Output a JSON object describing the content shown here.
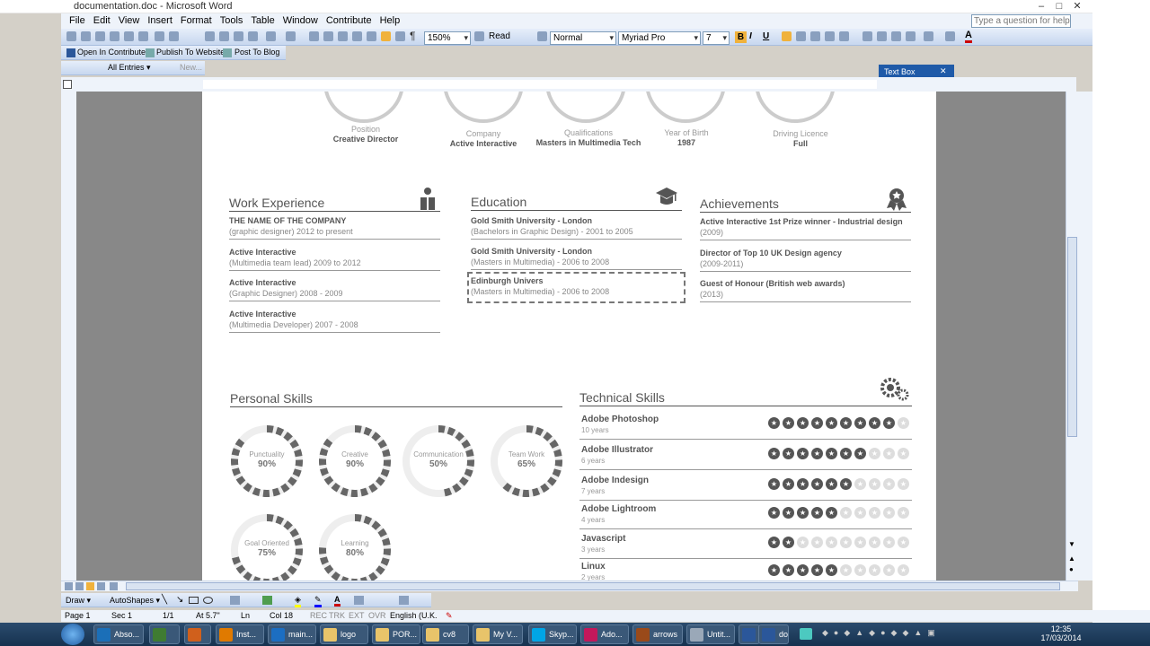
{
  "window": {
    "title": "documentation.doc - Microsoft Word"
  },
  "menu": [
    "File",
    "Edit",
    "View",
    "Insert",
    "Format",
    "Tools",
    "Table",
    "Window",
    "Contribute",
    "Help"
  ],
  "help_placeholder": "Type a question for help",
  "toolbar": {
    "zoom": "150%",
    "read": "Read",
    "style": "Normal",
    "font": "Myriad Pro",
    "size": "7"
  },
  "contribute": {
    "open": "Open In Contribute",
    "publish": "Publish To Website",
    "blog": "Post To Blog",
    "entries": "All Entries",
    "new": "New..."
  },
  "textbox_toolbar": {
    "title": "Text Box"
  },
  "resume": {
    "info": [
      {
        "label": "Position",
        "value": "Creative Director"
      },
      {
        "label": "Company",
        "value": "Active Interactive"
      },
      {
        "label": "Qualifications",
        "value": "Masters in Multimedia Tech"
      },
      {
        "label": "Year of Birth",
        "value": "1987"
      },
      {
        "label": "Driving Licence",
        "value": "Full"
      }
    ],
    "work": {
      "title": "Work Experience",
      "items": [
        {
          "a": "THE NAME OF THE COMPANY",
          "b": "(graphic designer) 2012 to present"
        },
        {
          "a": "Active Interactive",
          "b": "(Multimedia team lead) 2009 to 2012"
        },
        {
          "a": "Active Interactive",
          "b": "(Graphic Designer) 2008 - 2009"
        },
        {
          "a": "Active Interactive",
          "b": "(Multimedia Developer) 2007 - 2008"
        }
      ]
    },
    "education": {
      "title": "Education",
      "items": [
        {
          "a": "Gold Smith University - London",
          "b": "(Bachelors in Graphic Design) - 2001 to 2005"
        },
        {
          "a": "Gold Smith University - London",
          "b": "(Masters in Multimedia) - 2006 to 2008"
        },
        {
          "a": "Edinburgh Univers",
          "b": "(Masters in Multimedia) - 2006 to 2008"
        }
      ]
    },
    "achievements": {
      "title": "Achievements",
      "items": [
        {
          "a": "Active Interactive 1st Prize winner - Industrial design",
          "b": "(2009)"
        },
        {
          "a": "Director of Top 10 UK Design agency",
          "b": "(2009-2011)"
        },
        {
          "a": "Guest of Honour (British web awards)",
          "b": "(2013)"
        }
      ]
    },
    "personal": {
      "title": "Personal Skills",
      "items": [
        {
          "label": "Punctuality",
          "pct": "90%",
          "v": 0.9
        },
        {
          "label": "Creative",
          "pct": "90%",
          "v": 0.9
        },
        {
          "label": "Communication",
          "pct": "50%",
          "v": 0.5
        },
        {
          "label": "Team Work",
          "pct": "65%",
          "v": 0.65
        },
        {
          "label": "Goal Oriented",
          "pct": "75%",
          "v": 0.75
        },
        {
          "label": "Learning",
          "pct": "80%",
          "v": 0.8
        }
      ]
    },
    "technical": {
      "title": "Technical Skills",
      "items": [
        {
          "name": "Adobe Photoshop",
          "years": "10 years",
          "stars": 9
        },
        {
          "name": "Adobe Illustrator",
          "years": "6 years",
          "stars": 7
        },
        {
          "name": "Adobe Indesign",
          "years": "7 years",
          "stars": 6
        },
        {
          "name": "Adobe Lightroom",
          "years": "4 years",
          "stars": 5
        },
        {
          "name": "Javascript",
          "years": "3 years",
          "stars": 2
        },
        {
          "name": "Linux",
          "years": "2 years",
          "stars": 5
        }
      ]
    }
  },
  "drawing": {
    "draw": "Draw",
    "autoshapes": "AutoShapes"
  },
  "status": {
    "page": "Page 1",
    "sec": "Sec 1",
    "pages": "1/1",
    "at": "At 5.7\"",
    "ln": "Ln",
    "col": "Col 18",
    "rec": "REC",
    "trk": "TRK",
    "ext": "EXT",
    "ovr": "OVR",
    "lang": "English (U.K."
  },
  "taskbar": [
    {
      "label": "Abso...",
      "color": "#1b6fb8"
    },
    {
      "label": "",
      "color": "#3f7b32"
    },
    {
      "label": "",
      "color": "#d0601c"
    },
    {
      "label": "Inst...",
      "color": "#e07a00"
    },
    {
      "label": "main...",
      "color": "#1c6ec2"
    },
    {
      "label": "logo",
      "color": "#e8c46a"
    },
    {
      "label": "POR...",
      "color": "#e8c46a"
    },
    {
      "label": "cv8",
      "color": "#e8c46a"
    },
    {
      "label": "My V...",
      "color": "#e8c46a"
    },
    {
      "label": "Skyp...",
      "color": "#00a5e6"
    },
    {
      "label": "Ado...",
      "color": "#c2185b"
    },
    {
      "label": "arrows",
      "color": "#9a4a1a"
    },
    {
      "label": "Untit...",
      "color": "#9aa8b8"
    },
    {
      "label": "",
      "color": "#2b579a"
    },
    {
      "label": "doc...",
      "color": "#2b579a"
    }
  ],
  "clock": {
    "time": "12:35",
    "date": "17/03/2014"
  },
  "colors": {
    "accent": "#1f5aa8",
    "star_on": "#555555",
    "star_off": "#dddddd"
  }
}
